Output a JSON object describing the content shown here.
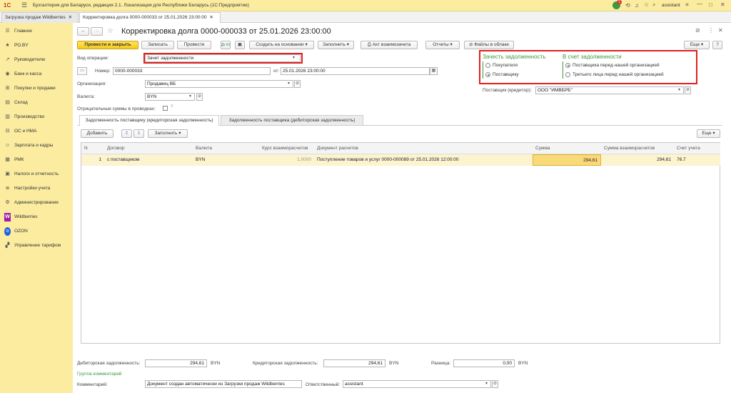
{
  "app": {
    "title": "Бухгалтерия для Беларуси, редакция 2.1. Локализация для Республики Беларусь   (1С:Предприятие)",
    "user": "assistant",
    "badge": "1"
  },
  "tabs": [
    {
      "label": "Загрузка продаж Wildberries"
    },
    {
      "label": "Корректировка долга 0000-000033 от 25.01.2026 23:00:00"
    }
  ],
  "sidebar": {
    "items": [
      {
        "label": "Главное",
        "icon": "menu-icon"
      },
      {
        "label": "РО.BY",
        "icon": "star-icon"
      },
      {
        "label": "Руководителю",
        "icon": "chart-icon"
      },
      {
        "label": "Банк и касса",
        "icon": "bank-icon"
      },
      {
        "label": "Покупки и продажи",
        "icon": "cart-icon"
      },
      {
        "label": "Склад",
        "icon": "warehouse-icon"
      },
      {
        "label": "Производство",
        "icon": "factory-icon"
      },
      {
        "label": "ОС и НМА",
        "icon": "car-icon"
      },
      {
        "label": "Зарплата и кадры",
        "icon": "people-icon"
      },
      {
        "label": "РМК",
        "icon": "register-icon"
      },
      {
        "label": "Налоги и отчетность",
        "icon": "tax-icon"
      },
      {
        "label": "Настройки учета",
        "icon": "settings-list-icon"
      },
      {
        "label": "Администрирование",
        "icon": "gear-icon"
      },
      {
        "label": "Wildberries",
        "icon": "wildberries-logo"
      },
      {
        "label": "OZON",
        "icon": "ozon-logo"
      },
      {
        "label": "Управление тарифом",
        "icon": "tariff-icon"
      }
    ]
  },
  "doc": {
    "title": "Корректировка долга 0000-000033 от 25.01.2026 23:00:00",
    "more": "Еще"
  },
  "toolbar": {
    "post_close": "Провести и закрыть",
    "save": "Записать",
    "post": "Провести",
    "create_basis": "Создать на основании",
    "fill": "Заполнить",
    "act": "Акт взаимозачета",
    "reports": "Отчеты",
    "files": "Файлы в облаке"
  },
  "form": {
    "op_type_label": "Вид операции:",
    "op_type_value": "Зачет задолженности",
    "number_label": "Номер:",
    "number_value": "0000-000033",
    "date_label": "от:",
    "date_value": "25.01.2026 23:00:00",
    "org_label": "Организация:",
    "org_value": "Продавец ВБ",
    "currency_label": "Валюта:",
    "currency_value": "BYN",
    "negative_label": "Отрицательные суммы в проводках:",
    "offset_title": "Зачесть задолженность",
    "offset_opt1": "Покупателя",
    "offset_opt2": "Поставщику",
    "against_title": "В счет задолженности",
    "against_opt1": "Поставщика перед нашей организацией",
    "against_opt2": "Третьего лица перед нашей организацией",
    "supplier_label": "Поставщик (кредитор):",
    "supplier_value": "ООО \"ИМВБРБ\""
  },
  "inner_tabs": [
    {
      "label": "Задолженность поставщику (кредиторская задолженность)"
    },
    {
      "label": "Задолженность поставщика (дебиторская задолженность)"
    }
  ],
  "table_toolbar": {
    "add": "Добавить",
    "fill": "Заполнить",
    "more": "Еще"
  },
  "table": {
    "headers": [
      "N",
      "Договор",
      "Валюта",
      "Курс взаиморасчетов",
      "Документ расчетов",
      "Сумма",
      "Сумма взаиморасчетов",
      "Счет учета"
    ],
    "rows": [
      [
        "1",
        "с поставщиком",
        "BYN",
        "1,0000",
        "Поступление товаров и услуг 0000-000089 от 25.01.2026 12:00:00",
        "294,61",
        "294,61",
        "76.7"
      ]
    ]
  },
  "footer": {
    "debit_label": "Дебиторская задолженность:",
    "debit_value": "294,61",
    "debit_cur": "BYN",
    "credit_label": "Кредиторская задолженность:",
    "credit_value": "294,61",
    "credit_cur": "BYN",
    "diff_label": "Разница:",
    "diff_value": "0,00",
    "diff_cur": "BYN",
    "comments_group": "Группа комментарий",
    "comment_label": "Комментарий:",
    "comment_value": "Документ создан автоматически из Загрузки продаж Wildberries",
    "responsible_label": "Ответственный:",
    "responsible_value": "assistant"
  }
}
